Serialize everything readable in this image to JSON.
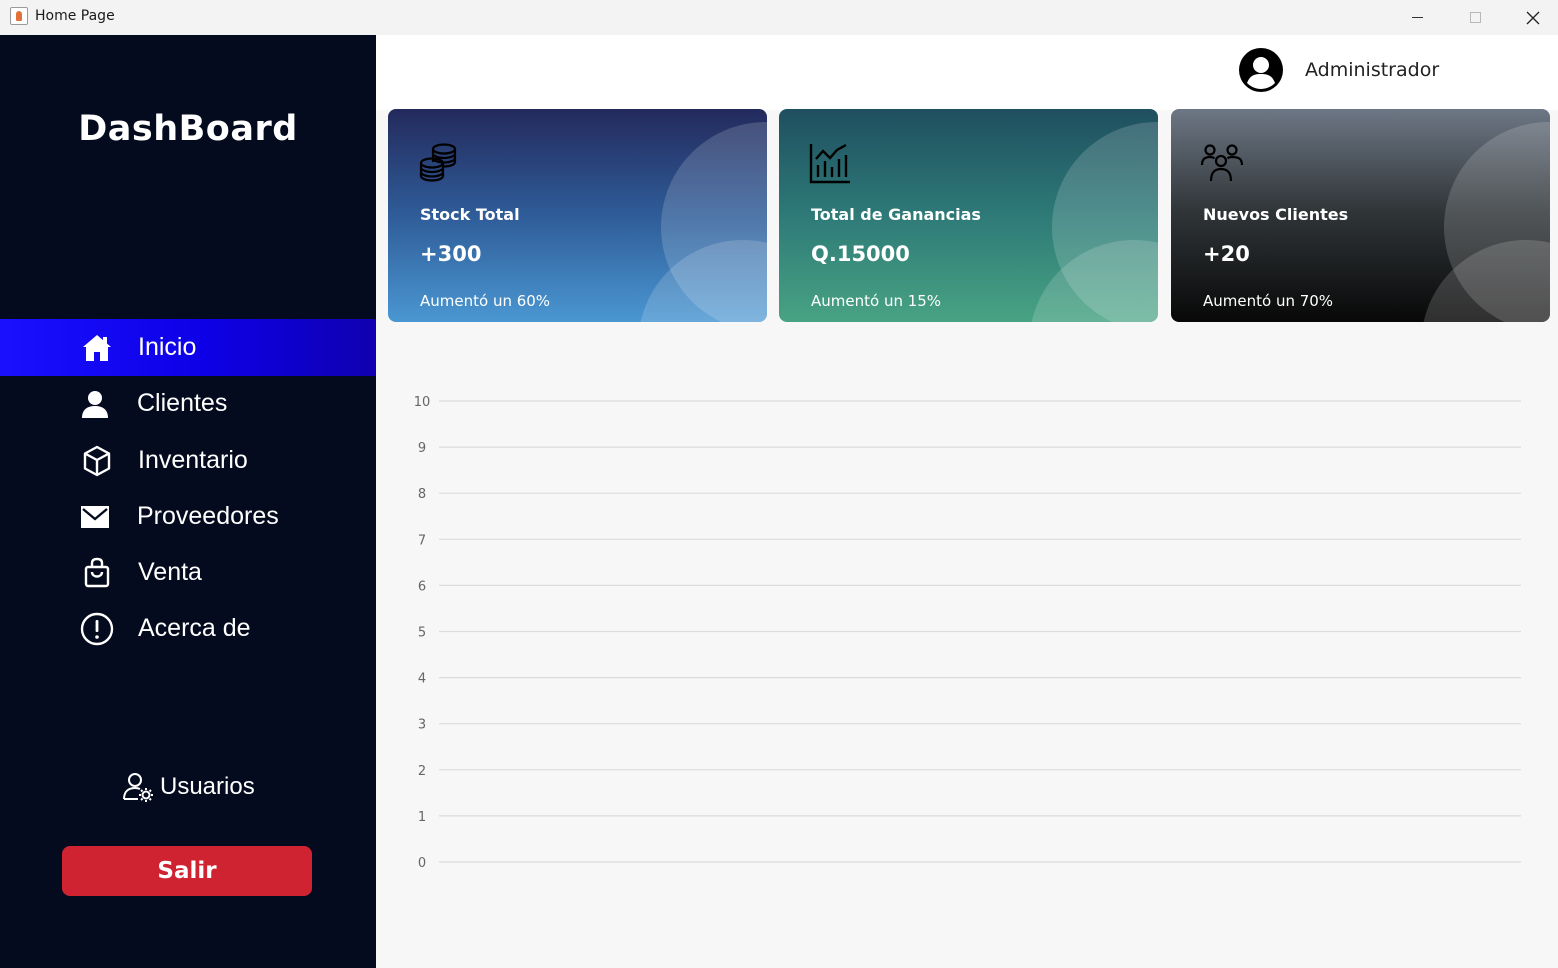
{
  "window": {
    "title": "Home Page"
  },
  "sidebar": {
    "brand": "DashBoard",
    "items": [
      {
        "label": "Inicio",
        "icon": "home-icon",
        "active": true
      },
      {
        "label": "Clientes",
        "icon": "user-icon",
        "active": false
      },
      {
        "label": "Inventario",
        "icon": "box-icon",
        "active": false
      },
      {
        "label": "Proveedores",
        "icon": "mail-icon",
        "active": false
      },
      {
        "label": "Venta",
        "icon": "shopping-bag-icon",
        "active": false
      },
      {
        "label": "Acerca de",
        "icon": "info-circle-icon",
        "active": false
      }
    ],
    "users_label": "Usuarios",
    "exit_label": "Salir"
  },
  "header": {
    "user_name": "Administrador"
  },
  "cards": [
    {
      "title": "Stock Total",
      "value": "+300",
      "note": "Aumentó un 60%",
      "icon": "coins-icon"
    },
    {
      "title": "Total de Ganancias",
      "value": "Q.15000",
      "note": "Aumentó un 15%",
      "icon": "bar-chart-icon"
    },
    {
      "title": "Nuevos Clientes",
      "value": "+20",
      "note": "Aumentó un 70%",
      "icon": "group-icon"
    }
  ],
  "colors": {
    "sidebar_bg": "#050b1e",
    "active_item": "#1a10ff",
    "exit_button": "#d02332",
    "main_bg": "#f7f7f7"
  },
  "chart_data": {
    "type": "line",
    "title": "",
    "xlabel": "",
    "ylabel": "",
    "ylim": [
      0,
      10
    ],
    "yticks": [
      "0",
      "1",
      "2",
      "3",
      "4",
      "5",
      "6",
      "7",
      "8",
      "9",
      "10"
    ],
    "series": [],
    "grid": true
  }
}
